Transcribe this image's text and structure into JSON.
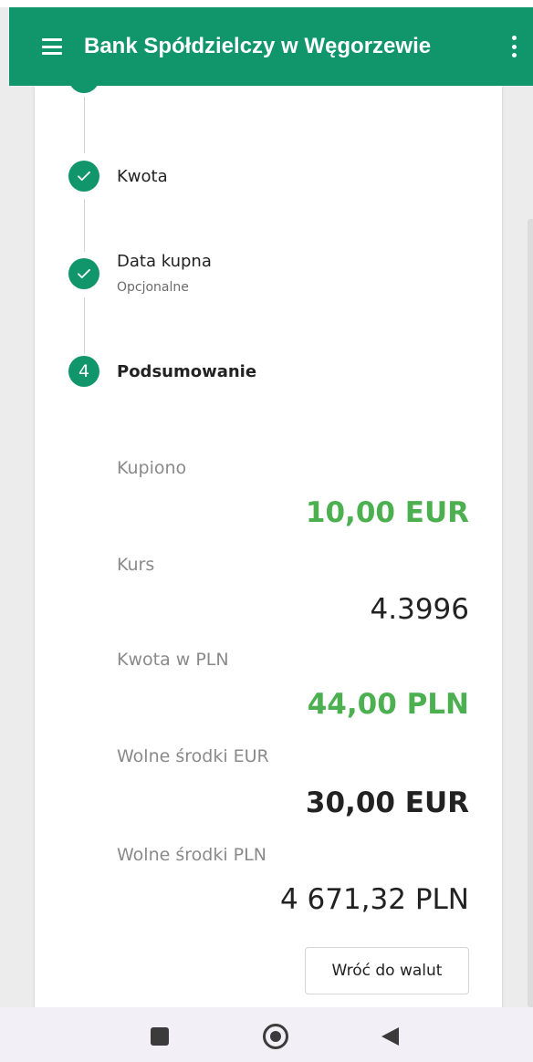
{
  "appbar": {
    "title": "Bank Spółdzielczy w Węgorzewie",
    "menu_icon": "hamburger-menu-icon",
    "more_icon": "more-vertical-icon"
  },
  "colors": {
    "brand": "#11956a",
    "amount_green": "#4caf50",
    "text_dark": "#222222",
    "text_muted": "#8a8a8a"
  },
  "steps": [
    {
      "label": "Kwota",
      "status": "completed",
      "icon": "check-icon"
    },
    {
      "label": "Data kupna",
      "sublabel": "Opcjonalne",
      "status": "completed",
      "icon": "check-icon"
    },
    {
      "number": "4",
      "label": "Podsumowanie",
      "status": "active"
    }
  ],
  "summary": {
    "bought_label": "Kupiono",
    "bought_value": "10,00 EUR",
    "rate_label": "Kurs",
    "rate_value": "4.3996",
    "pln_amount_label": "Kwota w PLN",
    "pln_amount_value": "44,00 PLN",
    "free_eur_label": "Wolne środki EUR",
    "free_eur_value": "30,00 EUR",
    "free_pln_label": "Wolne środki PLN",
    "free_pln_value": "4 671,32 PLN"
  },
  "actions": {
    "back_to_currencies": "Wróć do walut"
  },
  "navbar": {
    "recents_icon": "square-recents-icon",
    "home_icon": "circle-home-icon",
    "back_icon": "triangle-back-icon"
  }
}
